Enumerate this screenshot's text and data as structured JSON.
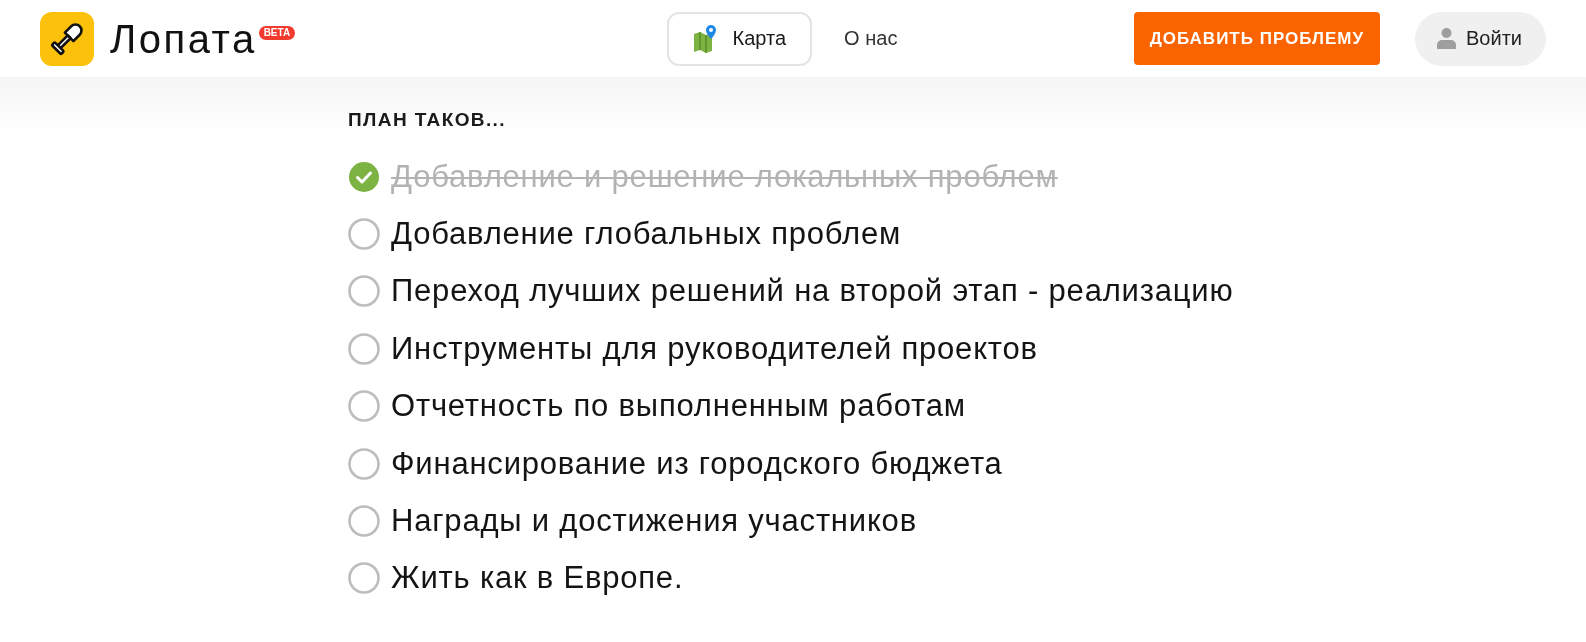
{
  "header": {
    "logo": {
      "name": "Лопата",
      "badge": "BETA"
    },
    "nav": [
      {
        "label": "Карта",
        "selected": true,
        "kind": "map"
      },
      {
        "label": "О нас",
        "selected": false,
        "kind": "text"
      }
    ],
    "add_button": "ДОБАВИТЬ ПРОБЛЕМУ",
    "login_button": "Войти"
  },
  "plan": {
    "title": "ПЛАН ТАКОВ...",
    "items": [
      {
        "label": "Добавление и решение локальных проблем",
        "checked": true
      },
      {
        "label": "Добавление глобальных проблем",
        "checked": false
      },
      {
        "label": "Переход лучших решений на второй этап - реализацию",
        "checked": false
      },
      {
        "label": "Инструменты для руководителей проектов",
        "checked": false
      },
      {
        "label": "Отчетность по выполненным работам",
        "checked": false
      },
      {
        "label": "Финансирование из городского бюджета",
        "checked": false
      },
      {
        "label": "Награды и достижения участников",
        "checked": false
      },
      {
        "label": "Жить как в Европе.",
        "checked": false
      }
    ]
  }
}
